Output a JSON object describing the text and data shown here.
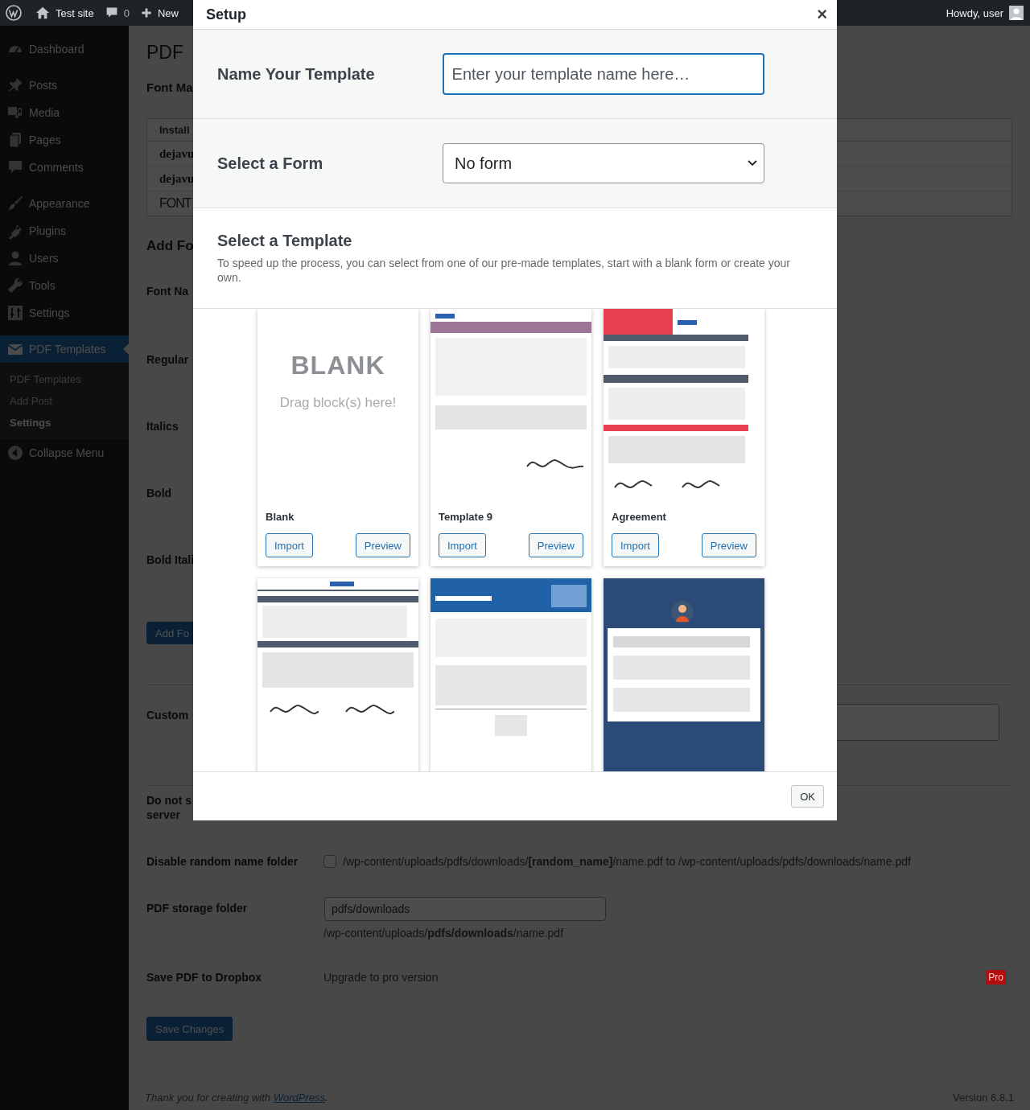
{
  "admin_bar": {
    "site": "Test site",
    "comments": "0",
    "new": "New",
    "greeting": "Howdy, user"
  },
  "sidebar": {
    "sections": [
      {
        "items": [
          {
            "label": "Dashboard",
            "selected": false
          }
        ]
      },
      {
        "items": [
          {
            "label": "Posts",
            "selected": false
          },
          {
            "label": "Media",
            "selected": false
          },
          {
            "label": "Pages",
            "selected": false
          },
          {
            "label": "Comments",
            "selected": false
          }
        ]
      },
      {
        "items": [
          {
            "label": "Appearance",
            "selected": false
          },
          {
            "label": "Plugins",
            "selected": false
          },
          {
            "label": "Users",
            "selected": false
          },
          {
            "label": "Tools",
            "selected": false
          },
          {
            "label": "Settings",
            "selected": false
          }
        ]
      },
      {
        "items": [
          {
            "label": "PDF Templates",
            "selected": true,
            "submenu": [
              {
                "label": "PDF Templates",
                "selected": false
              },
              {
                "label": "Add Post",
                "selected": false
              },
              {
                "label": "Settings",
                "selected": true
              }
            ]
          }
        ]
      }
    ],
    "collapse": "Collapse Menu"
  },
  "page": {
    "title": "PDF",
    "font_manager": {
      "heading": "Font Ma",
      "table_header": "Install",
      "rows": [
        {
          "text": "dejavu",
          "kind": "bold"
        },
        {
          "text": "dejavu",
          "kind": "bold"
        },
        {
          "text": "FONT",
          "kind": "light"
        }
      ]
    },
    "add_font": {
      "heading": "Add Fo",
      "fields": [
        "Font Na",
        "Regular",
        "Italics",
        "Bold",
        "Bold Itali"
      ],
      "button": "Add Fo"
    },
    "custom": {
      "label": "Custom"
    },
    "save_note": {
      "lines": [
        "Do not s",
        "server"
      ]
    },
    "settings": [
      {
        "kind": "checkbox",
        "label": "Disable random name folder",
        "checked": false,
        "text": "/wp-content/uploads/pdfs/downloads/**[random_name]**/name.pdf to /wp-content/uploads/pdfs/downloads/name.pdf"
      },
      {
        "kind": "input",
        "label": "PDF storage folder",
        "value": "pdfs/downloads",
        "note": "/wp-content/uploads/**pdfs/downloads**/name.pdf"
      },
      {
        "kind": "pro",
        "label": "Save PDF to Dropbox",
        "text": "Upgrade to pro version",
        "badge": "Pro"
      }
    ],
    "save_button": "Save Changes",
    "footer": {
      "before": "Thank you for creating with ",
      "link": "WordPress",
      "after": "."
    },
    "version": "Version 6.8.1"
  },
  "modal": {
    "title": "Setup",
    "close": "×",
    "name_field": {
      "label": "Name Your Template",
      "placeholder": "Enter your template name here…"
    },
    "form_field": {
      "label": "Select a Form",
      "value": "No form"
    },
    "templates": {
      "heading": "Select a Template",
      "description": "To speed up the process, you can select from one of our pre-made templates, start with a blank form or create your own.",
      "items": [
        {
          "thumbnail": {
            "kind": "blank",
            "heading": "BLANK",
            "hint": "Drag block(s) here!"
          },
          "title": "Blank",
          "buttons": [
            "Import",
            "Preview"
          ]
        },
        {
          "thumbnail": {
            "kind": "picture"
          },
          "title": "Template 9",
          "buttons": [
            "Import",
            "Preview"
          ]
        },
        {
          "thumbnail": {
            "kind": "picture"
          },
          "title": "Agreement",
          "buttons": [
            "Import",
            "Preview"
          ]
        },
        {
          "thumbnail": {
            "kind": "picture"
          }
        },
        {
          "thumbnail": {
            "kind": "picture"
          }
        },
        {
          "thumbnail": {
            "kind": "picture"
          }
        }
      ]
    },
    "ok": "OK"
  }
}
